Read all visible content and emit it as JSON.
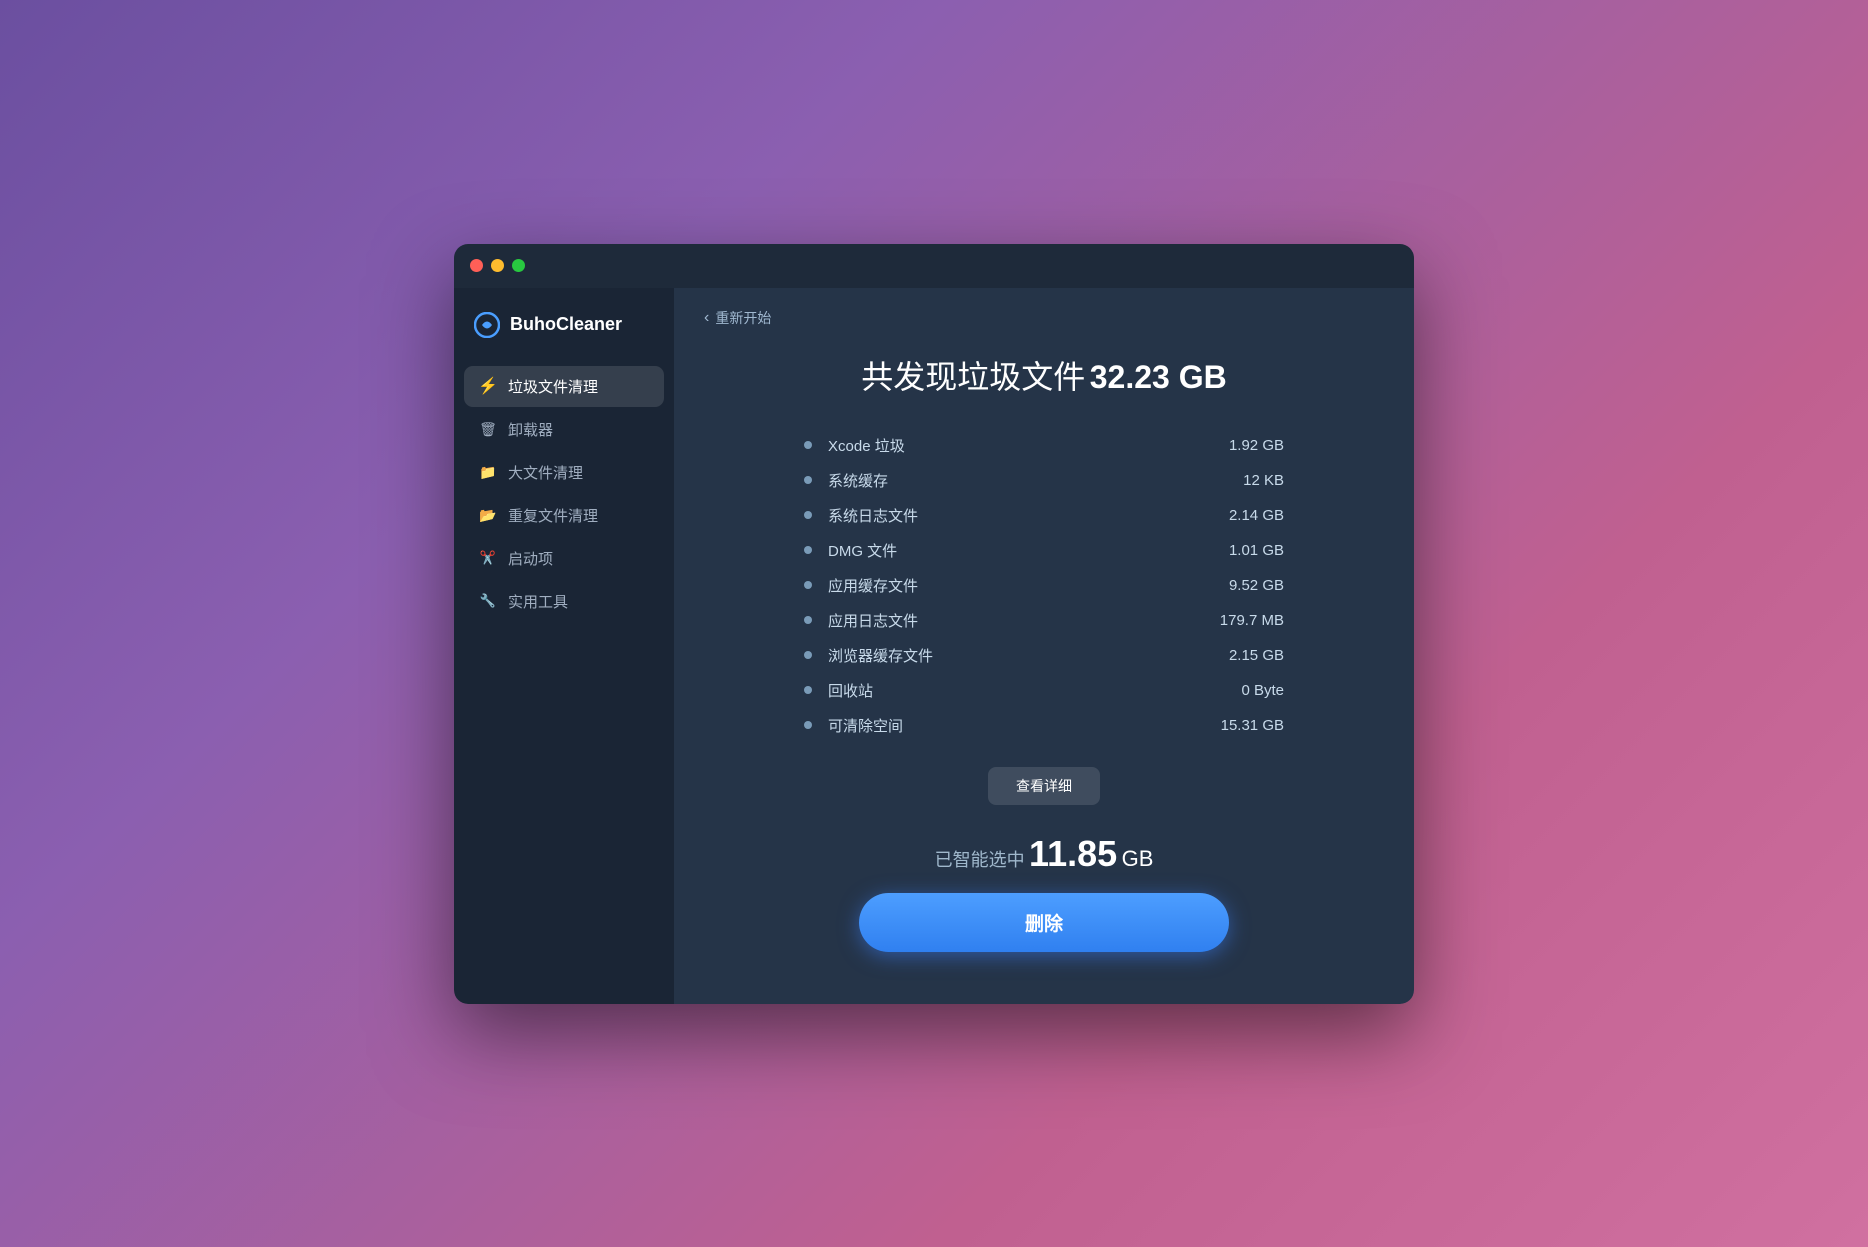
{
  "window": {
    "title": "BuhoCleaner"
  },
  "sidebar": {
    "logo": {
      "text": "BuhoCleaner"
    },
    "items": [
      {
        "id": "junk",
        "label": "垃圾文件清理",
        "icon": "⚡",
        "active": true
      },
      {
        "id": "uninstall",
        "label": "卸载器",
        "icon": "🗑",
        "active": false
      },
      {
        "id": "large",
        "label": "大文件清理",
        "icon": "📁",
        "active": false
      },
      {
        "id": "duplicate",
        "label": "重复文件清理",
        "icon": "📂",
        "active": false
      },
      {
        "id": "startup",
        "label": "启动项",
        "icon": "✂",
        "active": false
      },
      {
        "id": "tools",
        "label": "实用工具",
        "icon": "🔧",
        "active": false
      }
    ]
  },
  "main": {
    "back_label": "重新开始",
    "headline": "共发现垃圾文件",
    "headline_size": "32.23 GB",
    "stats": [
      {
        "label": "Xcode 垃圾",
        "value": "1.92 GB"
      },
      {
        "label": "系统缓存",
        "value": "12 KB"
      },
      {
        "label": "系统日志文件",
        "value": "2.14 GB"
      },
      {
        "label": "DMG 文件",
        "value": "1.01 GB"
      },
      {
        "label": "应用缓存文件",
        "value": "9.52 GB"
      },
      {
        "label": "应用日志文件",
        "value": "179.7 MB"
      },
      {
        "label": "浏览器缓存文件",
        "value": "2.15 GB"
      },
      {
        "label": "回收站",
        "value": "0 Byte"
      },
      {
        "label": "可清除空间",
        "value": "15.31 GB"
      }
    ],
    "detail_btn_label": "查看详细",
    "smart_prefix": "已智能选中",
    "smart_size": "11.85",
    "smart_unit": "GB",
    "delete_btn_label": "删除"
  }
}
